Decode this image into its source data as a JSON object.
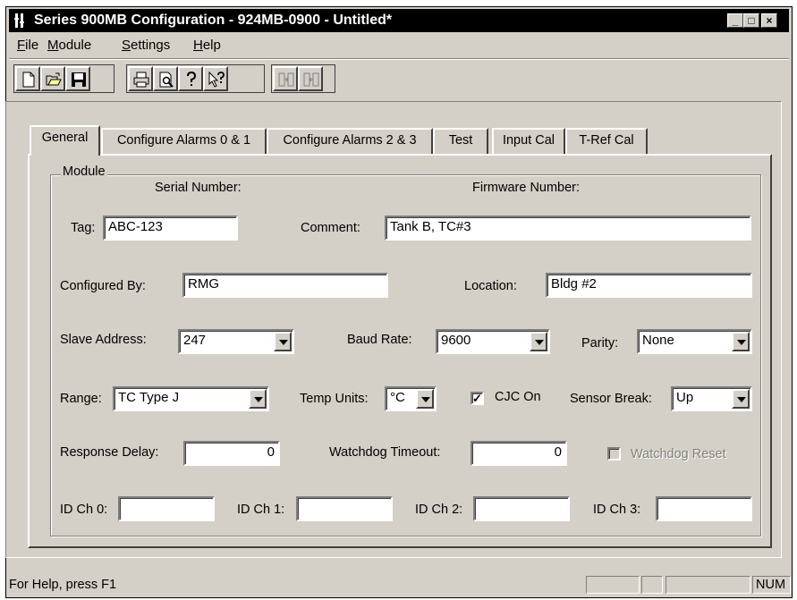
{
  "window": {
    "title": "Series 900MB Configuration - 924MB-0900 - Untitled*",
    "controls": {
      "minimize": "_",
      "maximize": "□",
      "close": "×"
    }
  },
  "menu": {
    "items": [
      {
        "label": "File",
        "accel": "F",
        "rest": "ile"
      },
      {
        "label": "Module",
        "accel": "M",
        "rest": "odule"
      },
      {
        "label": "Settings",
        "accel": "S",
        "rest": "ettings"
      },
      {
        "label": "Help",
        "accel": "H",
        "rest": "elp"
      }
    ]
  },
  "toolbar": {
    "buttons": [
      "new-icon",
      "open-icon",
      "save-icon",
      "print-icon",
      "print-preview-icon",
      "about-icon",
      "context-help-icon",
      "download-icon",
      "upload-icon"
    ]
  },
  "tabs": [
    "General",
    "Configure Alarms 0 & 1",
    "Configure Alarms 2 & 3",
    "Test",
    "Input Cal",
    "T-Ref Cal"
  ],
  "active_tab": "General",
  "module": {
    "group_label": "Module",
    "serial_number_label": "Serial Number:",
    "firmware_number_label": "Firmware Number:",
    "tag_label": "Tag:",
    "tag_value": "ABC-123",
    "comment_label": "Comment:",
    "comment_value": "Tank B, TC#3",
    "configured_by_label": "Configured By:",
    "configured_by_value": "RMG",
    "location_label": "Location:",
    "location_value": "Bldg #2",
    "slave_address_label": "Slave Address:",
    "slave_address_value": "247",
    "baud_rate_label": "Baud Rate:",
    "baud_rate_value": "9600",
    "parity_label": "Parity:",
    "parity_value": "None",
    "range_label": "Range:",
    "range_value": "TC Type J",
    "temp_units_label": "Temp Units:",
    "temp_units_value": "°C",
    "cjc_label": "CJC On",
    "cjc_checked": true,
    "sensor_break_label": "Sensor Break:",
    "sensor_break_value": "Up",
    "response_delay_label": "Response Delay:",
    "response_delay_value": "0",
    "watchdog_timeout_label": "Watchdog Timeout:",
    "watchdog_timeout_value": "0",
    "watchdog_reset_label": "Watchdog Reset",
    "watchdog_reset_checked": false,
    "id_ch0_label": "ID Ch 0:",
    "id_ch0_value": "",
    "id_ch1_label": "ID Ch 1:",
    "id_ch1_value": "",
    "id_ch2_label": "ID Ch 2:",
    "id_ch2_value": "",
    "id_ch3_label": "ID Ch 3:",
    "id_ch3_value": ""
  },
  "status": {
    "help_text": "For Help, press F1",
    "num_indicator": "NUM"
  },
  "colors": {
    "face": "#d4d0c8",
    "title_bar": "#000000",
    "shadow": "#808080",
    "highlight": "#ffffff"
  }
}
